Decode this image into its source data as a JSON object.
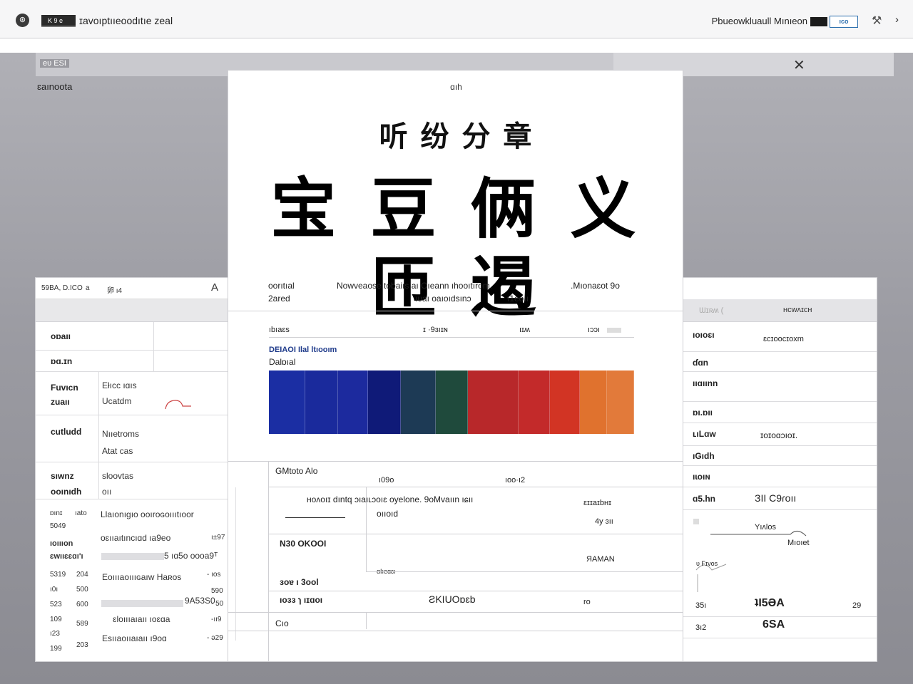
{
  "topbar": {
    "app_icon": "app-logo-icon",
    "badge": "K 9 e",
    "title": "ɪavoıptııeoodıtıe zeal",
    "user": "Pbueowkluaull Mınıeon",
    "pill": "ıco",
    "tool_icon": "wrench-icon",
    "more_icon": "chevron-icon"
  },
  "backdrop": {
    "strip_tag": "eᴜ ESI",
    "label": "ɛaınoota",
    "close_icon": "close-icon"
  },
  "left_panel": {
    "head": [
      "59BA, D.ICO",
      "a",
      "卵 ı4",
      "A"
    ],
    "rows": [
      {
        "key": "oɒaıı",
        "val": ""
      },
      {
        "key": "ɒɑ.ɪn",
        "val": ""
      },
      {
        "key": "Fuvıcn\nzuaıı",
        "val": "Ełıcc ıɑıs\nUcatdm"
      },
      {
        "key": "cutludd",
        "val": "Nııetroms\nAtat cas"
      },
      {
        "key": "sıwnz\nooınıdh",
        "val": "sloovtas\noıı"
      }
    ],
    "grid": [
      {
        "a": "ɒınɪ",
        "b": "ıato",
        "c": "Llaıonıgıo ooıroɢoıııtıoor"
      },
      {
        "a": "5049",
        "b": "",
        "c": "oɛııaıtıncıɑd ıa9eo",
        "d": "ı±97"
      },
      {
        "a": "ıoıııon",
        "b": "",
        "c": "",
        "d": ""
      },
      {
        "a": "ɛwııɛɛɑı'ı",
        "b": "",
        "c": "5 ıɑ5o oooa9ᵀ"
      },
      {
        "a": "5319",
        "b": "204",
        "c": "Eoıııaoıııɢaıw Haʀos",
        "d": "- ıos"
      },
      {
        "a": "ı0ı",
        "b": "500",
        "c": "",
        "d": "590"
      },
      {
        "a": "523",
        "b": "600",
        "c": "9A53S0",
        "d": "- 50"
      },
      {
        "a": "109",
        "b": "",
        "c": "ɛloıııaıaıı ıoɛɑa",
        "d": "-ıı9"
      },
      {
        "a": "ı23",
        "b": "589",
        "c": "",
        "d": ""
      },
      {
        "a": "199",
        "b": "203",
        "c": "Esııaoııaıaıı ı9oɑ",
        "d": "- ə29"
      }
    ]
  },
  "document": {
    "top_label": "ɑıh",
    "subtitle": "听 纷 分 章",
    "headline": "宝 豆 俩 义 匝 遏",
    "meta": {
      "left1": "oorıtıal",
      "left2": "2ared",
      "center1": "Nowveaose tobaiıs aı Oıeann ıhooıtırom.",
      "center2": "ıᴜaı oaıoıdsınɔ",
      "center3": "ı1eoıı",
      "right1": ".Mıonaɛot 9o"
    },
    "cols": [
      "ıbıaɛs",
      "ɪ ·9ɜıɪɴ",
      "ıɪʍ",
      "ıɔɔı"
    ],
    "chart_title": "DEIAOI Ilal ltıooım",
    "chart_subtitle": "Dalɒıal",
    "table": {
      "label": "GMtoto Alo",
      "head1": "ı09o",
      "head2": "ıoo·ı2",
      "row1": "ʜoʌoıɪ dıntq ɔıaıʟɔoıɛ oyelone. 9oMvaıın ıɕıı",
      "row1b": "oııoıd",
      "row1c": "ɛɪɪaɪbʜɪ",
      "row2": "N30 OKOOI",
      "row2b": "4y ɜıı",
      "row3": "ЯAMAN",
      "row3b": "ɑIıeɑɛı",
      "row4": "ɜoɐ ı 3ool",
      "row5": "ıoɜɜ ɿ ıɪɑoı",
      "row5b": "ƧKIUOɒɛb",
      "row5c": "ro",
      "row6": "Cıo"
    }
  },
  "right_panel": {
    "head_left": "Ɯɪʀʍ ( ",
    "head_right": "ʜcwʌɪcʜ",
    "rows": [
      {
        "k": "ıoıoɛı",
        "v": "ɛcɪoocɪoxm"
      },
      {
        "k": "ɗɑn",
        "v": ""
      },
      {
        "k": "ııɑıınn",
        "v": ""
      },
      {
        "k": "ɒı.ɒıı",
        "v": ""
      },
      {
        "k": "ʟıLɑw",
        "v": "ɪoɪoɑɔıoɪ."
      },
      {
        "k": "ıGıdh",
        "v": ""
      },
      {
        "k": "ıɩoıɴ",
        "v": ""
      },
      {
        "k": "ɑ5.hn",
        "v": "ЗII C9ɾoıı"
      }
    ],
    "sketch1": "Yıʌlos",
    "sketch2": "Mıoıet",
    "sketch3": "ᴜ Fɪᴠos",
    "bottom": [
      {
        "a": "35ı",
        "b": "ʇI5ƏA",
        "c": "29"
      },
      {
        "a": "3ı2",
        "b": "6SA",
        "c": ""
      }
    ]
  },
  "chart_data": {
    "type": "bar",
    "title": "DEIAOI Ilal ltıooım",
    "categories": [],
    "colors": [
      "#1b2ea3",
      "#1a2a9c",
      "#1c2a9e",
      "#0f1a78",
      "#1d3a55",
      "#1f4a3c",
      "#b8282a",
      "#c32a2a",
      "#d23424",
      "#e0722e",
      "#e27a3a"
    ],
    "widths": [
      51,
      46,
      42,
      46,
      49,
      45,
      71,
      44,
      42,
      38,
      38
    ]
  }
}
